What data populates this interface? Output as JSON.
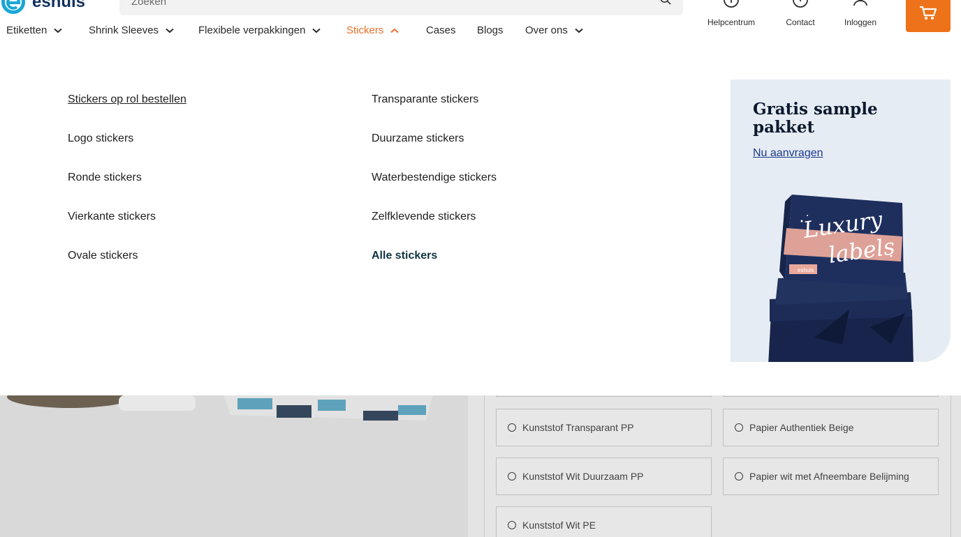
{
  "brand": {
    "logo_text": "eshuis",
    "accent": "#ee7219",
    "nav_active": "#e8702a",
    "link_dark": "#0e3440"
  },
  "search": {
    "placeholder": "Zoeken"
  },
  "utility": {
    "help_label": "Helpcentrum",
    "contact_label": "Contact",
    "login_label": "Inloggen"
  },
  "nav": {
    "items": [
      {
        "label": "Etiketten",
        "has_dropdown": true,
        "active": false
      },
      {
        "label": "Shrink Sleeves",
        "has_dropdown": true,
        "active": false
      },
      {
        "label": "Flexibele verpakkingen",
        "has_dropdown": true,
        "active": false
      },
      {
        "label": "Stickers",
        "has_dropdown": true,
        "active": true,
        "open": true
      },
      {
        "label": "Cases",
        "has_dropdown": false,
        "active": false
      },
      {
        "label": "Blogs",
        "has_dropdown": false,
        "active": false
      },
      {
        "label": "Over ons",
        "has_dropdown": true,
        "active": false
      }
    ]
  },
  "mega_menu": {
    "col1": [
      "Stickers op rol bestellen",
      "Logo stickers",
      "Ronde stickers",
      "Vierkante stickers",
      "Ovale stickers"
    ],
    "col2": [
      "Transparante stickers",
      "Duurzame stickers",
      "Waterbestendige stickers",
      "Zelfklevende stickers",
      "Alle stickers"
    ],
    "promo": {
      "title": "Gratis sample pakket",
      "link": "Nu aanvragen",
      "box_text_1": "Luxury",
      "box_text_2": "labels",
      "box_brand": "eshuis",
      "bg_color": "#e6ecf3",
      "box_color": "#1e2f5e",
      "stripe_color": "#e9a89b"
    }
  },
  "background_page": {
    "material_options": [
      "Kunststof Transparant PP",
      "Papier Authentiek Beige",
      "Kunststof Wit Duurzaam PP",
      "Papier wit met Afneembare Belijming",
      "Kunststof Wit PE"
    ]
  }
}
